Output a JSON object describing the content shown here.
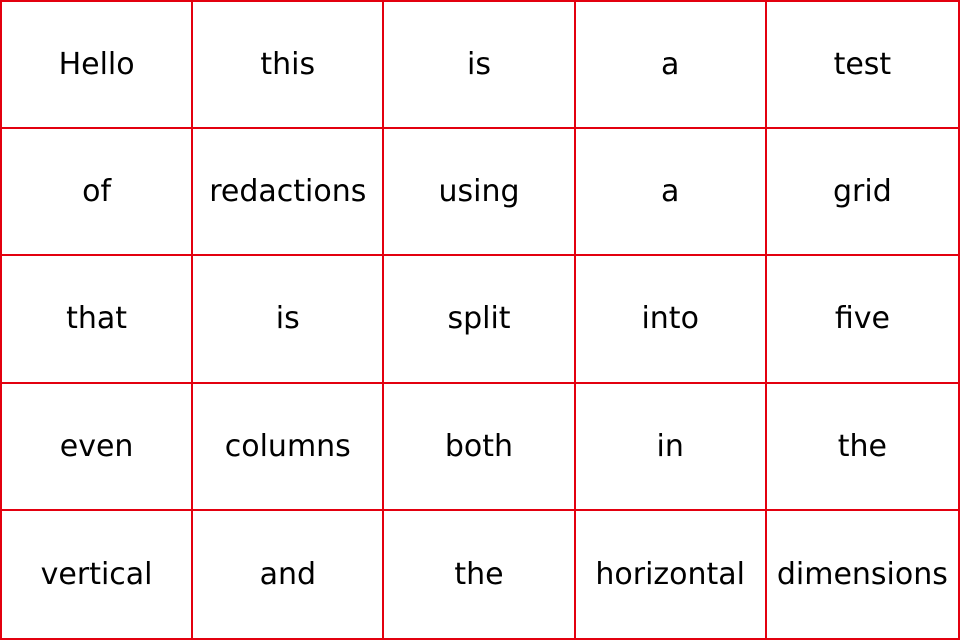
{
  "colors": {
    "grid_line": "#e3000f",
    "text": "#000000",
    "background": "#ffffff"
  },
  "rows": [
    [
      "Hello",
      "this",
      "is",
      "a",
      "test"
    ],
    [
      "of",
      "redactions",
      "using",
      "a",
      "grid"
    ],
    [
      "that",
      "is",
      "split",
      "into",
      "five"
    ],
    [
      "even",
      "columns",
      "both",
      "in",
      "the"
    ],
    [
      "vertical",
      "and",
      "the",
      "horizontal",
      "dimensions"
    ]
  ]
}
